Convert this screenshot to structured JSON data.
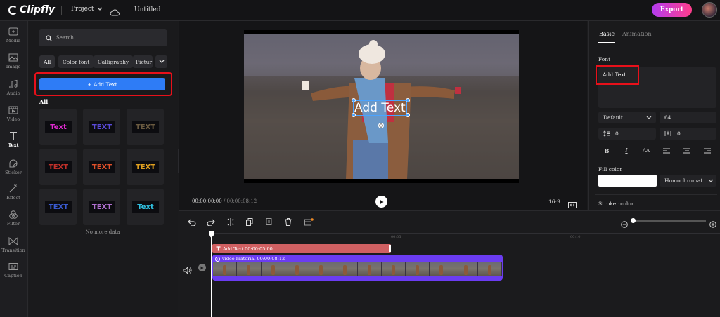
{
  "app": {
    "logo_text": "Clipfly",
    "project_label": "Project",
    "doc_title": "Untitled",
    "export_label": "Export"
  },
  "rail": [
    {
      "label": "Media",
      "icon": "media-icon"
    },
    {
      "label": "Image",
      "icon": "image-icon"
    },
    {
      "label": "Audio",
      "icon": "audio-icon"
    },
    {
      "label": "Video",
      "icon": "video-icon"
    },
    {
      "label": "Text",
      "icon": "text-icon",
      "active": true
    },
    {
      "label": "Sticker",
      "icon": "sticker-icon"
    },
    {
      "label": "Effect",
      "icon": "effect-icon"
    },
    {
      "label": "Filter",
      "icon": "filter-icon"
    },
    {
      "label": "Transition",
      "icon": "transition-icon"
    },
    {
      "label": "Caption",
      "icon": "caption-icon"
    }
  ],
  "panel": {
    "search_placeholder": "Search...",
    "chips": [
      "All",
      "Color font",
      "Calligraphy",
      "Pictur"
    ],
    "add_text_label": "+ Add Text",
    "section_heading": "All",
    "tiles": [
      {
        "label": "Text",
        "color": "#e02ad0"
      },
      {
        "label": "TEXT",
        "color": "#5a4ad8"
      },
      {
        "label": "TEXT",
        "color": "#6a5a40"
      },
      {
        "label": "TEXT",
        "color": "#c0302a"
      },
      {
        "label": "TEXT",
        "color": "#e0502a"
      },
      {
        "label": "TEXT",
        "color": "#e0a020"
      },
      {
        "label": "TEXT",
        "color": "#3a5ad0"
      },
      {
        "label": "TEXT",
        "color": "#b070d0"
      },
      {
        "label": "Text",
        "color": "#30c0e0"
      }
    ],
    "no_more": "No more data"
  },
  "preview": {
    "overlay_text": "Add Text",
    "current_time": "00:00:00:00",
    "total_time": "/ 00:00:08:12",
    "ratio": "16:9"
  },
  "right_panel": {
    "tabs": [
      "Basic",
      "Animation"
    ],
    "font_label": "Font",
    "font_text": "Add Text",
    "font_family": "Default",
    "font_size": "64",
    "line_spacing": "0",
    "letter_spacing": "0",
    "format_buttons": [
      "B",
      "I",
      "AA",
      "align-left",
      "align-center",
      "align-right"
    ],
    "fill_label": "Fill color",
    "fill_mode": "Homochromat...",
    "stroke_label": "Stroker color"
  },
  "timeline": {
    "ruler_marks": [
      "00:05",
      "00:10"
    ],
    "text_clip_label": "Add Text 00:00:05:00",
    "video_clip_label": "video material 00:00:08:12"
  }
}
